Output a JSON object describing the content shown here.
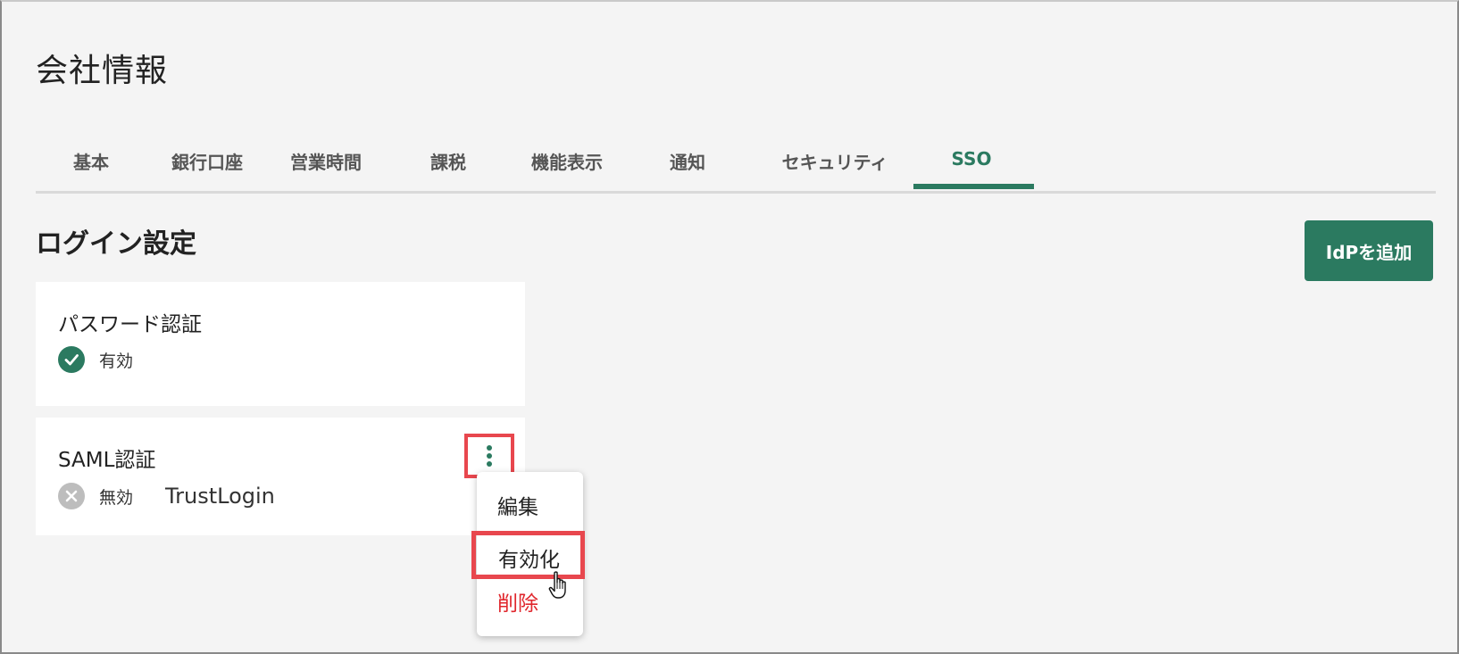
{
  "page": {
    "title": "会社情報"
  },
  "tabs": [
    {
      "label": "基本",
      "active": false
    },
    {
      "label": "銀行口座",
      "active": false
    },
    {
      "label": "営業時間",
      "active": false
    },
    {
      "label": "課税",
      "active": false
    },
    {
      "label": "機能表示",
      "active": false
    },
    {
      "label": "通知",
      "active": false
    },
    {
      "label": "セキュリティ",
      "active": false
    },
    {
      "label": "SSO",
      "active": true
    }
  ],
  "login_settings": {
    "title": "ログイン設定",
    "add_idp_label": "IdPを追加"
  },
  "auth_methods": [
    {
      "title": "パスワード認証",
      "status": "有効",
      "status_icon": "check-circle-icon"
    },
    {
      "title": "SAML認証",
      "status": "無効",
      "status_icon": "x-circle-icon",
      "provider": "TrustLogin"
    }
  ],
  "context_menu": {
    "edit": "編集",
    "enable": "有効化",
    "delete": "削除"
  },
  "colors": {
    "accent": "#2b7a60",
    "highlight": "#e8474e",
    "danger": "#e0262c",
    "disabled": "#bdbdbd"
  }
}
